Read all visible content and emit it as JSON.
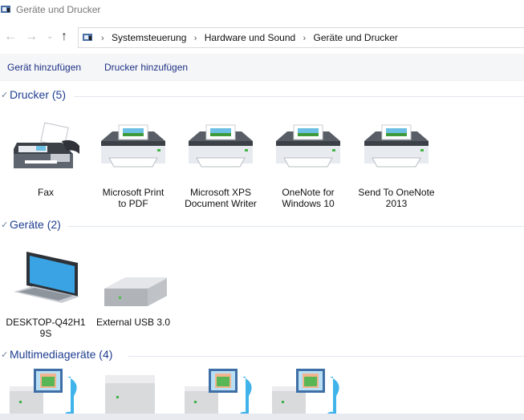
{
  "window": {
    "title": "Geräte und Drucker"
  },
  "nav": {
    "back_icon": "arrow-left-icon",
    "forward_icon": "arrow-right-icon",
    "recent_icon": "chevron-down-icon",
    "up_icon": "arrow-up-icon"
  },
  "breadcrumb": [
    {
      "label": "Systemsteuerung"
    },
    {
      "label": "Hardware und Sound"
    },
    {
      "label": "Geräte und Drucker"
    }
  ],
  "toolbar": {
    "add_device": "Gerät hinzufügen",
    "add_printer": "Drucker hinzufügen"
  },
  "groups": {
    "printers": {
      "title": "Drucker (5)",
      "items": [
        {
          "line1": "Fax",
          "line2": "",
          "icon": "fax-icon"
        },
        {
          "line1": "Microsoft Print",
          "line2": "to PDF",
          "icon": "printer-icon"
        },
        {
          "line1": "Microsoft XPS",
          "line2": "Document Writer",
          "icon": "printer-icon"
        },
        {
          "line1": "OneNote for",
          "line2": "Windows 10",
          "icon": "printer-icon"
        },
        {
          "line1": "Send To OneNote",
          "line2": "2013",
          "icon": "printer-icon"
        }
      ]
    },
    "devices": {
      "title": "Geräte (2)",
      "items": [
        {
          "line1": "DESKTOP-Q42H1",
          "line2": "9S",
          "icon": "laptop-icon"
        },
        {
          "line1": "External USB 3.0",
          "line2": "",
          "icon": "external-drive-icon"
        }
      ]
    },
    "multimedia": {
      "title": "Multimediageräte (4)",
      "items": [
        {
          "icon": "media-device-icon"
        },
        {
          "icon": "media-server-icon"
        },
        {
          "icon": "media-device-icon"
        },
        {
          "icon": "media-device-icon"
        }
      ]
    }
  }
}
